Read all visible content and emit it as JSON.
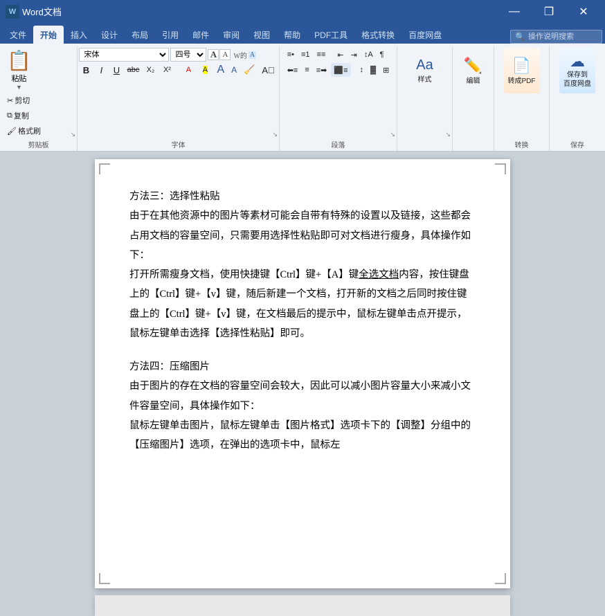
{
  "titlebar": {
    "icon_text": "W",
    "title": "Word文档",
    "minimize": "—",
    "restore": "❐",
    "close": "✕"
  },
  "quickaccess": {
    "save": "💾",
    "undo": "↩",
    "redo": "↪"
  },
  "search": {
    "placeholder": "操作说明搜索"
  },
  "ribbon": {
    "tabs": [
      "文件",
      "开始",
      "插入",
      "设计",
      "布局",
      "引用",
      "邮件",
      "审阅",
      "视图",
      "帮助",
      "PDF工具",
      "格式转换",
      "百度网盘"
    ],
    "active_tab": "开始",
    "groups": {
      "clipboard": {
        "label": "剪贴板",
        "paste": "粘贴",
        "cut": "剪切",
        "copy": "复制",
        "format_painter": "格式刷"
      },
      "font": {
        "label": "字体",
        "font_name": "宋体",
        "font_size": "四号",
        "bold": "B",
        "italic": "I",
        "underline": "U",
        "strikethrough": "abc",
        "subscript": "X₂",
        "superscript": "X²",
        "increase_size": "A",
        "decrease_size": "A",
        "clear_format": "A",
        "font_color": "A",
        "highlight": "A"
      },
      "paragraph": {
        "label": "段落",
        "bullets": "≡",
        "numbering": "≡",
        "multilevel": "≡",
        "decrease_indent": "⇤",
        "increase_indent": "⇥",
        "sort": "↕",
        "show_marks": "¶",
        "align_left": "≡",
        "center": "≡",
        "align_right": "≡",
        "justify": "≡",
        "line_spacing": "↕",
        "shading": "▓",
        "borders": "⊞"
      },
      "styles": {
        "label": "样式"
      },
      "editing": {
        "label": "编辑",
        "btn": "编辑"
      },
      "convert": {
        "label": "转换",
        "to_pdf": "转成PDF"
      },
      "save": {
        "label": "保存",
        "save_to_cloud": "保存到\n百度网盘"
      }
    }
  },
  "document": {
    "section3_title": "方法三：选择性粘贴",
    "section3_body1": "由于在其他资源中的图片等素材可能会自带有特殊的设置以及链接，这些都会占用文档的容量空间，只需要用选择性粘贴即可对文档进行瘦身，具体操作如下：",
    "section3_body2_part1": "打开所需瘦身文档，使用快捷键【Ctrl】键+【A】键",
    "section3_body2_bold": "全选文档",
    "section3_body2_part2": "内容，按住键盘上的【Ctrl】键+【v】键，随后新建一个文档，打开新的文档之后同时按住键盘上的【Ctrl】键+【v】键，在文档最后的提示中，鼠标左键单击点开提示，鼠标左键单击选择【选择性粘贴】即可。",
    "section4_title": "方法四：压缩图片",
    "section4_body1": "由于图片的存在文档的容量空间会较大，因此可以减小图片容量大小来减小文件容量空间，具体操作如下：",
    "section4_body2": "鼠标左键单击图片，鼠标左键单击【图片格式】选项卡下的【调整】分组中的【压缩图片】选项，在弹出的选项卡中，鼠标左"
  }
}
